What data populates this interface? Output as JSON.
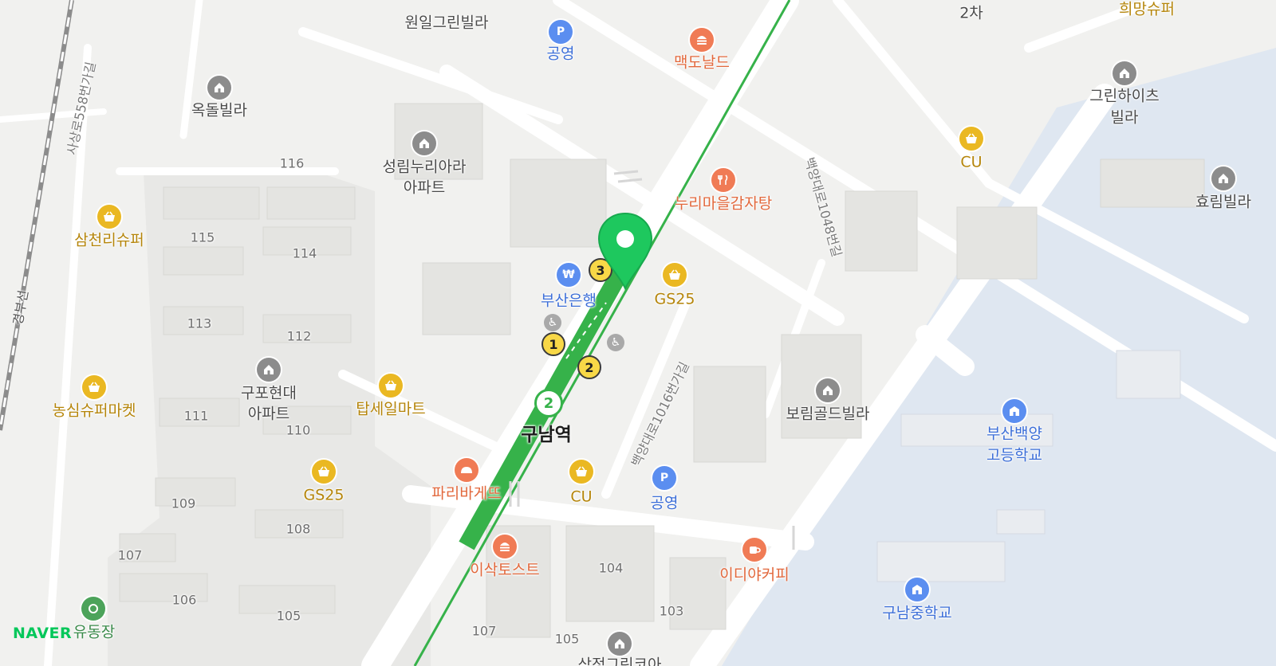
{
  "map": {
    "provider": "NAVER",
    "station": "구남역",
    "line_badge": "2",
    "exits": [
      "1",
      "2",
      "3"
    ],
    "roads": {
      "sasang": "사상로558번가길",
      "gyeongbu": "경부선",
      "baekyang1048": "백양대로1048번길",
      "baekyang1016": "백양대로1016번가길"
    },
    "places": {
      "wonil": "원일그린빌라",
      "parking_top": "공영",
      "mcdonalds": "맥도날드",
      "huimang": "희망슈퍼",
      "top2": "2차",
      "okdol": "옥돌빌라",
      "greenheights_1": "그린하이츠",
      "greenheights_2": "빌라",
      "cu_top": "CU",
      "seongrim_1": "성림누리아라",
      "seongrim_2": "아파트",
      "nuri": "누리마을감자탕",
      "hyorim": "효림빌라",
      "samcheonri": "삼천리슈퍼",
      "busanbank": "부산은행",
      "gs25_station": "GS25",
      "nongsim": "농심슈퍼마켓",
      "gupo_1": "구포현대",
      "gupo_2": "아파트",
      "tapseil": "탑세일마트",
      "borim": "보림골드빌라",
      "busan_hs_1": "부산백양",
      "busan_hs_2": "고등학교",
      "gs25_left": "GS25",
      "paris": "파리바게뜨",
      "cu_station": "CU",
      "parking_mid": "공영",
      "isaac": "이삭토스트",
      "ediya": "이디야커피",
      "gunam_ms": "구남중학교",
      "playground": "유동장",
      "samjeong": "삼정그린코아"
    },
    "building_numbers": {
      "b116": "116",
      "b115": "115",
      "b114": "114",
      "b113": "113",
      "b112": "112",
      "b111": "111",
      "b110": "110",
      "b109": "109",
      "b108": "108",
      "b107": "107",
      "b106": "106",
      "b105": "105",
      "b104": "104",
      "b103": "103",
      "b107b": "107",
      "b105b": "105"
    }
  },
  "colors": {
    "subway_line2": "#36b24a",
    "marker": "#1ec85e",
    "water": "#dfe7f1",
    "road": "#ffffff",
    "block": "#e6e6e3"
  },
  "icons": {
    "store": "basket-icon",
    "food": "burger-icon",
    "restaurant": "fork-knife-icon",
    "building": "house-icon",
    "parking": "parking-icon",
    "bank": "won-icon",
    "school": "school-icon",
    "cafe": "cup-icon",
    "bakery": "bread-icon",
    "wheelchair": "wheelchair-icon",
    "marker": "location-pin-icon"
  }
}
